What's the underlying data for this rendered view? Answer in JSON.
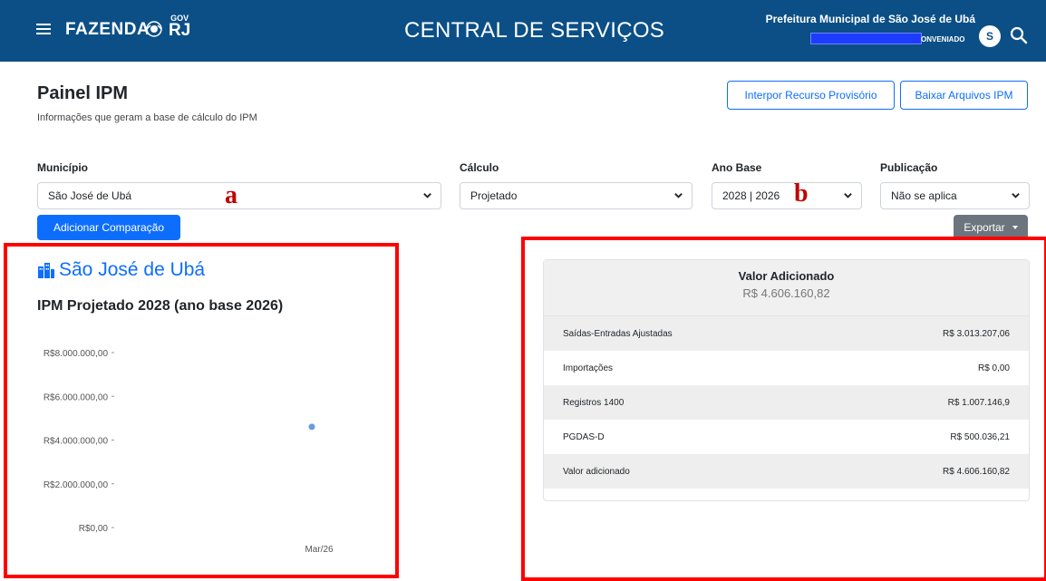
{
  "header": {
    "brand": "FAZENDA",
    "gov": "GOV",
    "rj": "RJ",
    "title": "CENTRAL DE SERVIÇOS",
    "user_name": "Prefeitura Municipal de São José de Ubá",
    "user_role": "ONVENIADO",
    "avatar_letter": "S"
  },
  "page": {
    "title": "Painel IPM",
    "subtitle": "Informações que geram a base de cálculo do IPM"
  },
  "actions": {
    "recurso": "Interpor Recurso Provisório",
    "baixar": "Baixar Arquivos IPM",
    "add_comparison": "Adicionar Comparação",
    "export": "Exportar"
  },
  "filters": {
    "municipio": {
      "label": "Município",
      "value": "São José de Ubá"
    },
    "calculo": {
      "label": "Cálculo",
      "value": "Projetado"
    },
    "ano_base": {
      "label": "Ano Base",
      "value": "2028 | 2026"
    },
    "publicacao": {
      "label": "Publicação",
      "value": "Não se aplica"
    }
  },
  "annotations": {
    "a": "a",
    "b": "b"
  },
  "chart_panel": {
    "municipality": "São José de Ubá",
    "title": "IPM Projetado 2028 (ano base 2026)"
  },
  "chart_data": {
    "type": "scatter",
    "title": "IPM Projetado 2028 (ano base 2026)",
    "x": [
      "Mar/26"
    ],
    "series": [
      {
        "values": [
          4606160.82
        ]
      }
    ],
    "yticks": [
      "R$8.000.000,00",
      "R$6.000.000,00",
      "R$4.000.000,00",
      "R$2.000.000,00",
      "R$0,00"
    ],
    "ylim": [
      0,
      8000000
    ],
    "point_color": "#6a9be0"
  },
  "summary": {
    "title": "Valor Adicionado",
    "total": "R$ 4.606.160,82",
    "rows": [
      {
        "label": "Saídas-Entradas Ajustadas",
        "value": "R$ 3.013.207,06"
      },
      {
        "label": "Importações",
        "value": "R$ 0,00"
      },
      {
        "label": "Registros 1400",
        "value": "R$ 1.007.146,9"
      },
      {
        "label": "PGDAS-D",
        "value": "R$ 500.036,21"
      },
      {
        "label": "Valor adicionado",
        "value": "R$ 4.606.160,82"
      }
    ]
  },
  "colors": {
    "topbar": "#0b4f86",
    "primary": "#0d6efd",
    "annotation_red": "#ff0000"
  }
}
